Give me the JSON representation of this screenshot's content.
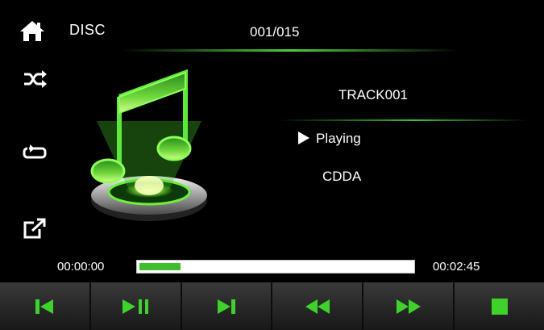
{
  "header": {
    "home_icon": "home-icon",
    "source": "DISC",
    "track_counter": "001/015"
  },
  "side_controls": [
    {
      "icon": "shuffle-icon"
    },
    {
      "icon": "repeat-icon"
    },
    {
      "icon": "external-link-icon"
    }
  ],
  "now_playing": {
    "track_name": "TRACK001",
    "status": "Playing",
    "format": "CDDA"
  },
  "progress": {
    "elapsed": "00:00:00",
    "total": "00:02:45",
    "fraction": 0.15
  },
  "controls": [
    {
      "icon": "previous-track-icon"
    },
    {
      "icon": "play-pause-icon"
    },
    {
      "icon": "next-track-icon"
    },
    {
      "icon": "rewind-icon"
    },
    {
      "icon": "fast-forward-icon"
    },
    {
      "icon": "stop-icon"
    }
  ],
  "colors": {
    "accent": "#3fbf2e",
    "background": "#000000",
    "control_bar": "#2a2a2a"
  }
}
